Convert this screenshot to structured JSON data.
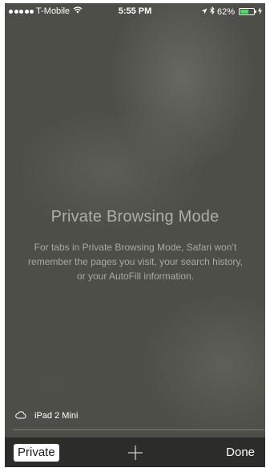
{
  "status_bar": {
    "carrier": "T-Mobile",
    "time": "5:55 PM",
    "battery_percent": "62%",
    "battery_level": 0.62,
    "icons": [
      "signal-dots-icon",
      "wifi-icon",
      "location-arrow-icon",
      "bluetooth-icon",
      "battery-icon",
      "charging-bolt-icon"
    ]
  },
  "private_mode": {
    "title": "Private Browsing Mode",
    "description": "For tabs in Private Browsing Mode, Safari won’t remember the pages you visit, your search history, or your AutoFill information."
  },
  "cloud_tabs": {
    "device_name": "iPad 2 Mini",
    "icon": "cloud-icon"
  },
  "toolbar": {
    "private_label": "Private",
    "add_icon": "plus-icon",
    "done_label": "Done"
  },
  "colors": {
    "background": "#4e4e49",
    "toolbar": "#2c2c2a",
    "battery": "#4cd964",
    "text_muted": "#aeaea8"
  }
}
